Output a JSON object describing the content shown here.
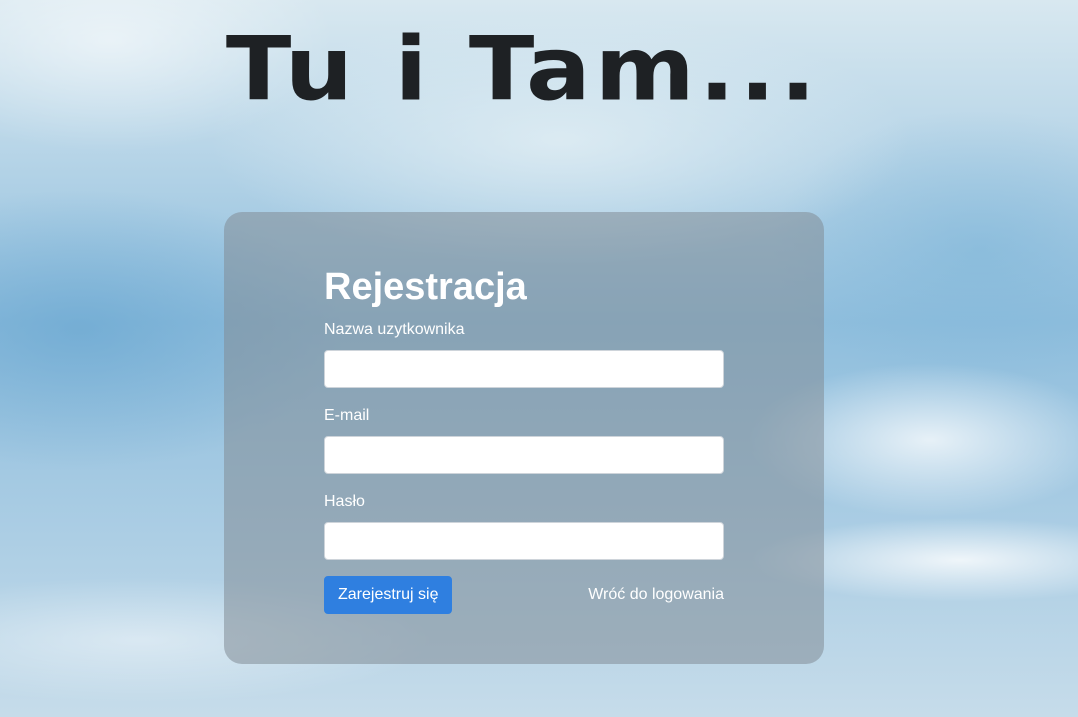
{
  "header": {
    "title": "Tu i Tam..."
  },
  "register_form": {
    "title": "Rejestracja",
    "username": {
      "label": "Nazwa uzytkownika",
      "value": "",
      "placeholder": ""
    },
    "email": {
      "label": "E-mail",
      "value": "",
      "placeholder": ""
    },
    "password": {
      "label": "Hasło",
      "value": "",
      "placeholder": ""
    },
    "submit_label": "Zarejestruj się",
    "back_link_label": "Wróć do logowania"
  },
  "colors": {
    "primary_button": "#2f7fe0",
    "title_text": "#1e2124",
    "card_overlay": "rgba(130,140,150,0.55)"
  }
}
